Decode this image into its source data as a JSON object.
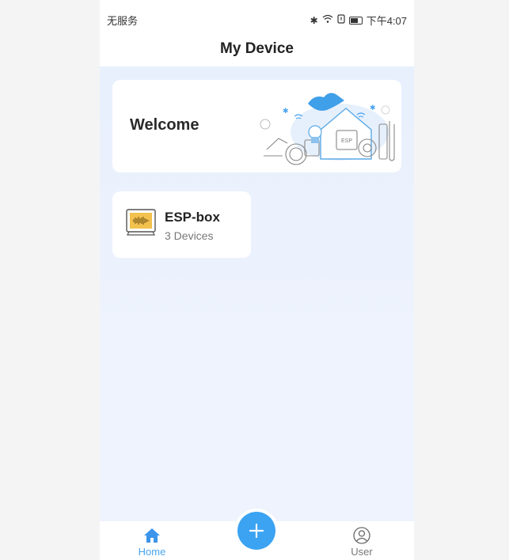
{
  "status_bar": {
    "carrier": "无服务",
    "time": "下午4:07",
    "icons": [
      "bluetooth-icon",
      "wifi-icon",
      "sim-icon",
      "battery-icon"
    ]
  },
  "header": {
    "title": "My Device"
  },
  "welcome": {
    "title": "Welcome",
    "illustration": "smart-home-illustration"
  },
  "devices": [
    {
      "name": "ESP-box",
      "count": "3 Devices",
      "icon": "esp-box-icon"
    }
  ],
  "tabbar": {
    "home_label": "Home",
    "user_label": "User",
    "add_icon": "plus-icon"
  },
  "colors": {
    "accent": "#3ba3f2",
    "background": "#eef3fc",
    "card": "#ffffff",
    "device_icon": "#f2c14e"
  }
}
